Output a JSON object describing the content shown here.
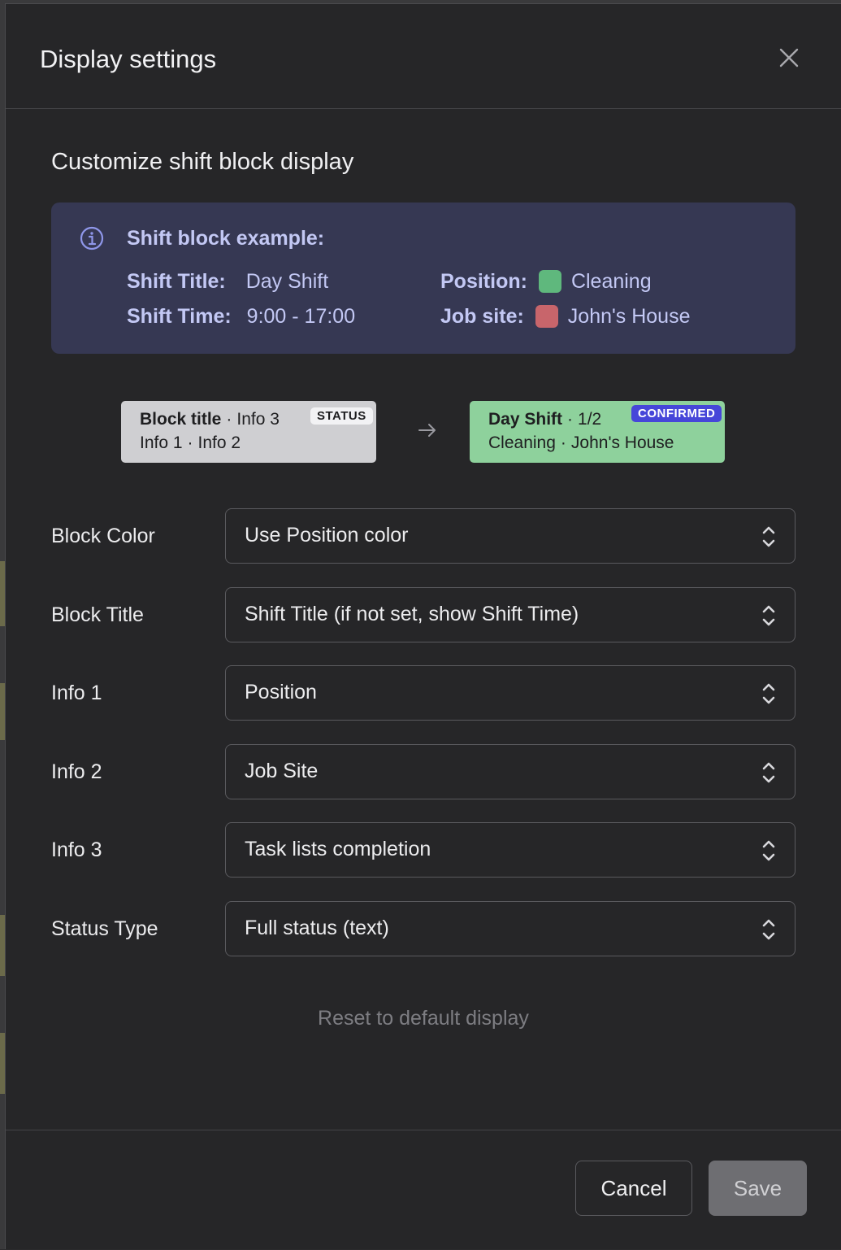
{
  "dialog": {
    "title": "Display settings",
    "section_title": "Customize shift block display"
  },
  "example": {
    "heading": "Shift block example:",
    "shift_title_label": "Shift Title:",
    "shift_title_value": "Day Shift",
    "shift_time_label": "Shift Time:",
    "shift_time_value": "9:00 - 17:00",
    "position_label": "Position:",
    "position_value": "Cleaning",
    "position_color": "#5fb87d",
    "job_site_label": "Job site:",
    "job_site_value": "John's House",
    "job_site_color": "#c8656b"
  },
  "template_block": {
    "title": "Block title",
    "info3": "Info 3",
    "info1": "Info 1",
    "info2": "Info 2",
    "status": "STATUS",
    "dot": "·"
  },
  "result_block": {
    "title": "Day Shift",
    "info3": "1/2",
    "info1": "Cleaning",
    "info2": "John's House",
    "status": "CONFIRMED",
    "dot": "·",
    "bg_color": "#8ed19c",
    "status_color": "#4646d9"
  },
  "settings": [
    {
      "label": "Block Color",
      "value": "Use Position color"
    },
    {
      "label": "Block Title",
      "value": "Shift Title (if not set, show Shift Time)"
    },
    {
      "label": "Info 1",
      "value": "Position"
    },
    {
      "label": "Info 2",
      "value": "Job Site"
    },
    {
      "label": "Info 3",
      "value": "Task lists completion"
    },
    {
      "label": "Status Type",
      "value": "Full status (text)"
    }
  ],
  "reset_label": "Reset to default display",
  "footer": {
    "cancel_label": "Cancel",
    "save_label": "Save"
  }
}
